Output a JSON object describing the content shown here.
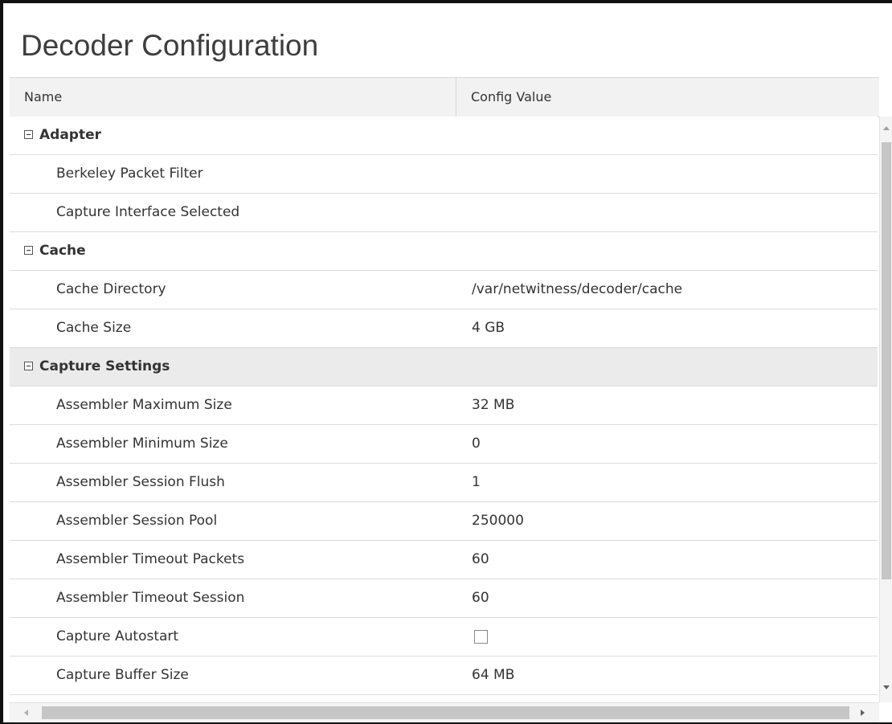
{
  "panel": {
    "title": "Decoder Configuration"
  },
  "columns": {
    "name": "Name",
    "value": "Config Value"
  },
  "groups": [
    {
      "label": "Adapter",
      "items": [
        {
          "name": "Berkeley Packet Filter",
          "value": ""
        },
        {
          "name": "Capture Interface Selected",
          "value": ""
        }
      ]
    },
    {
      "label": "Cache",
      "items": [
        {
          "name": "Cache Directory",
          "value": "/var/netwitness/decoder/cache"
        },
        {
          "name": "Cache Size",
          "value": "4 GB"
        }
      ]
    },
    {
      "label": "Capture Settings",
      "items": [
        {
          "name": "Assembler Maximum Size",
          "value": "32 MB"
        },
        {
          "name": "Assembler Minimum Size",
          "value": "0"
        },
        {
          "name": "Assembler Session Flush",
          "value": "1"
        },
        {
          "name": "Assembler Session Pool",
          "value": "250000"
        },
        {
          "name": "Assembler Timeout Packets",
          "value": "60"
        },
        {
          "name": "Assembler Timeout Session",
          "value": "60"
        },
        {
          "name": "Capture Autostart",
          "value": "",
          "checked": false
        },
        {
          "name": "Capture Buffer Size",
          "value": "64 MB"
        }
      ]
    }
  ],
  "icons": {
    "group_toggle": "collapse-minus-icon",
    "scroll_up": "scroll-up-arrow-icon",
    "scroll_down": "scroll-down-arrow-icon",
    "scroll_left": "scroll-left-arrow-icon",
    "scroll_right": "scroll-right-arrow-icon"
  },
  "colors": {
    "header_bg": "#f2f2f2",
    "selected_row_bg": "#ebebeb",
    "row_border": "#dcdcdc",
    "text": "#333333"
  }
}
